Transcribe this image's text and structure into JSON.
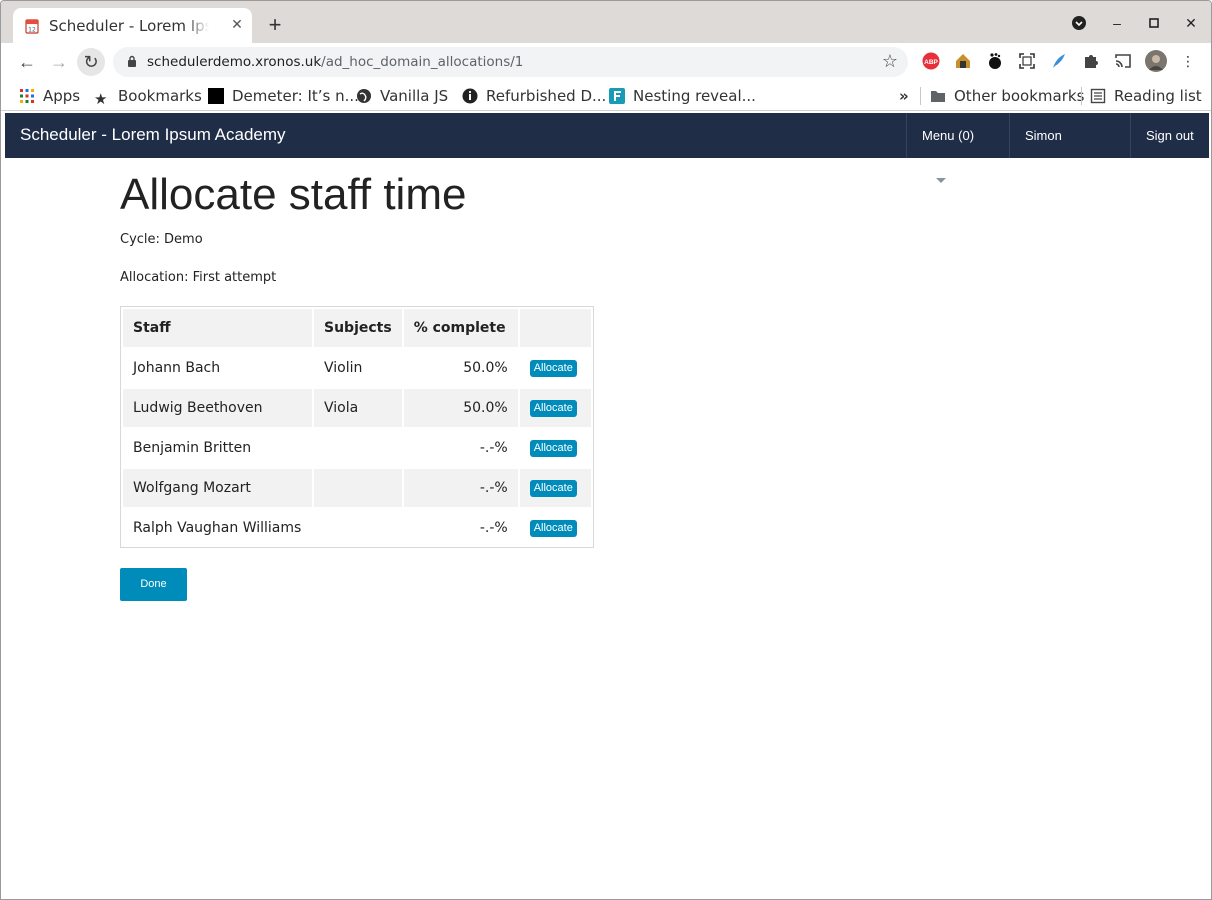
{
  "browser": {
    "tab_title": "Scheduler - Lorem Ipsum Academy",
    "new_tab": "+",
    "url_domain": "schedulerdemo.xronos.uk",
    "url_path": "/ad_hoc_domain_allocations/1",
    "extensions": [
      "ABP"
    ],
    "bookmarks": [
      {
        "label": "Apps",
        "icon": "apps-grid-icon"
      },
      {
        "label": "Bookmarks",
        "icon": "star-icon"
      },
      {
        "label": "Demeter: It’s n...",
        "icon": "black-square-icon"
      },
      {
        "label": "Vanilla JS",
        "icon": "globe-icon"
      },
      {
        "label": "Refurbished D...",
        "icon": "info-circle-icon"
      },
      {
        "label": "Nesting reveal...",
        "icon": "f-logo-icon"
      }
    ],
    "bookmarks_more": "»",
    "other_bookmarks": "Other bookmarks",
    "reading_list": "Reading list"
  },
  "appbar": {
    "brand": "Scheduler - Lorem Ipsum Academy",
    "menu": "Menu (0)",
    "user": "Simon Philpotts",
    "signout": "Sign out"
  },
  "page": {
    "title": "Allocate staff time",
    "cycle": "Cycle: Demo",
    "allocation": "Allocation: First attempt",
    "headers": {
      "staff": "Staff",
      "subjects": "Subjects",
      "complete": "% complete",
      "action": ""
    },
    "rows": [
      {
        "staff": "Johann Bach",
        "subjects": "Violin",
        "complete": "50.0%",
        "action": "Allocate"
      },
      {
        "staff": "Ludwig Beethoven",
        "subjects": "Viola",
        "complete": "50.0%",
        "action": "Allocate"
      },
      {
        "staff": "Benjamin Britten",
        "subjects": "",
        "complete": "-.-%",
        "action": "Allocate"
      },
      {
        "staff": "Wolfgang Mozart",
        "subjects": "",
        "complete": "-.-%",
        "action": "Allocate"
      },
      {
        "staff": "Ralph Vaughan Williams",
        "subjects": "",
        "complete": "-.-%",
        "action": "Allocate"
      }
    ],
    "done": "Done"
  },
  "colors": {
    "appbar": "#1f2d47",
    "button": "#008cba"
  }
}
